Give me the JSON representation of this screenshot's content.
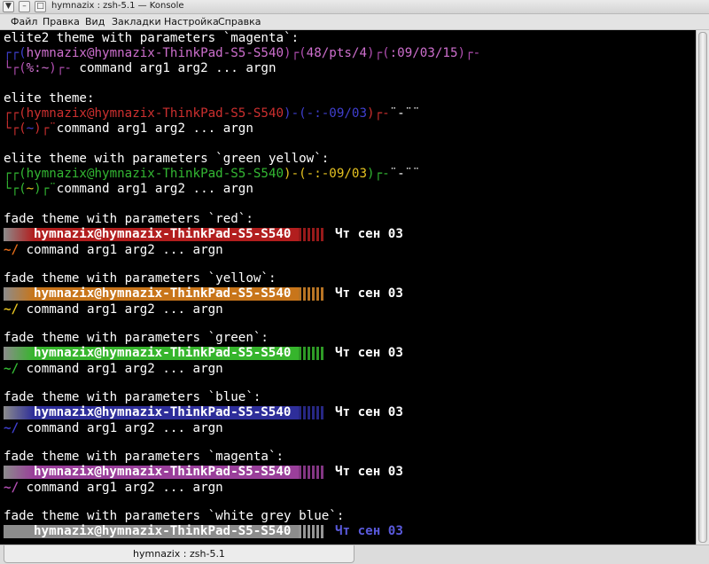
{
  "window": {
    "title": "hymnazix : zsh-5.1 — Konsole"
  },
  "menubar": [
    "Файл",
    "Правка",
    "Вид",
    "Закладки",
    "Настройка",
    "Справка"
  ],
  "tab": {
    "label": "hymnazix : zsh-5.1"
  },
  "lines": {
    "l0": "elite2 theme with parameters `magenta`:",
    "l1_open": "┌┌(",
    "l1_user": "hymnazix@hymnazix-ThinkPad-S5-S540",
    "l1_mid1": ")┌(",
    "l1_pts": "48/pts/4",
    "l1_mid2": ")┌(",
    "l1_date": ":09/03/15",
    "l1_close": ")┌-",
    "l1_end": "-",
    "l2_open": "└┌(",
    "l2_dir": "%:~",
    "l2_close": ")┌-",
    "l2_cmd": " command arg1 arg2 ... argn",
    "l4": "elite theme:",
    "l5_open": "┌┌(",
    "l5_user": "hymnazix@hymnazix-ThinkPad-S5-S540",
    "l5_mid": ")-(",
    "l5_date": "-:-09/03",
    "l5_close": ")┌-",
    "l5_tail": "¨-¨¨",
    "l6_open": "└┌(",
    "l6_dir": "~",
    "l6_close": ")┌¨",
    "l6_cmd": "command arg1 arg2 ... argn",
    "l8": "elite theme with parameters `green yellow`:",
    "l9_open": "┌┌(",
    "l9_user": "hymnazix@hymnazix-ThinkPad-S5-S540",
    "l9_mid": ")-(",
    "l9_date": "-:-09/03",
    "l9_close": ")┌-",
    "l9_tail": "¨-¨¨",
    "l10_open": "└┌(",
    "l10_dir": "~",
    "l10_close": ")┌¨",
    "l10_cmd": "command arg1 arg2 ... argn"
  },
  "fade_blocks": [
    {
      "header": "fade theme with parameters `red`:",
      "user": "hymnazix@hymnazix-ThinkPad-S5-S540",
      "date": "Чт сен 03",
      "prompt": "~/",
      "cmd": " command arg1 arg2 ... argn",
      "band_color": "#b21e1e",
      "fade_color": "#b21e1e",
      "prompt_color": "#e06a18",
      "date_color": "#ffffff"
    },
    {
      "header": "fade theme with parameters `yellow`:",
      "user": "hymnazix@hymnazix-ThinkPad-S5-S540",
      "date": "Чт сен 03",
      "prompt": "~/",
      "cmd": " command arg1 arg2 ... argn",
      "band_color": "#c8751a",
      "fade_color": "#d9892a",
      "prompt_color": "#e6c320",
      "date_color": "#ffffff"
    },
    {
      "header": "fade theme with parameters `green`:",
      "user": "hymnazix@hymnazix-ThinkPad-S5-S540",
      "date": "Чт сен 03",
      "prompt": "~/",
      "cmd": " command arg1 arg2 ... argn",
      "band_color": "#36b52c",
      "fade_color": "#36b52c",
      "prompt_color": "#33b833",
      "date_color": "#ffffff"
    },
    {
      "header": "fade theme with parameters `blue`:",
      "user": "hymnazix@hymnazix-ThinkPad-S5-S540",
      "date": "Чт сен 03",
      "prompt": "~/",
      "cmd": " command arg1 arg2 ... argn",
      "band_color": "#2e2e9a",
      "fade_color": "#2e2e9a",
      "prompt_color": "#3f3fd0",
      "date_color": "#ffffff"
    },
    {
      "header": "fade theme with parameters `magenta`:",
      "user": "hymnazix@hymnazix-ThinkPad-S5-S540",
      "date": "Чт сен 03",
      "prompt": "~/",
      "cmd": " command arg1 arg2 ... argn",
      "band_color": "#9a3f9a",
      "fade_color": "#9a3f9a",
      "prompt_color": "#b24eb2",
      "date_color": "#ffffff"
    },
    {
      "header": "fade theme with parameters `white grey blue`:",
      "user": "hymnazix@hymnazix-ThinkPad-S5-S540",
      "date": "Чт сен 03",
      "prompt": "",
      "cmd": "",
      "band_color": "#8c8c8c",
      "fade_color": "#b0b0b0",
      "prompt_color": "#ffffff",
      "date_color": "#5a5adc"
    }
  ]
}
